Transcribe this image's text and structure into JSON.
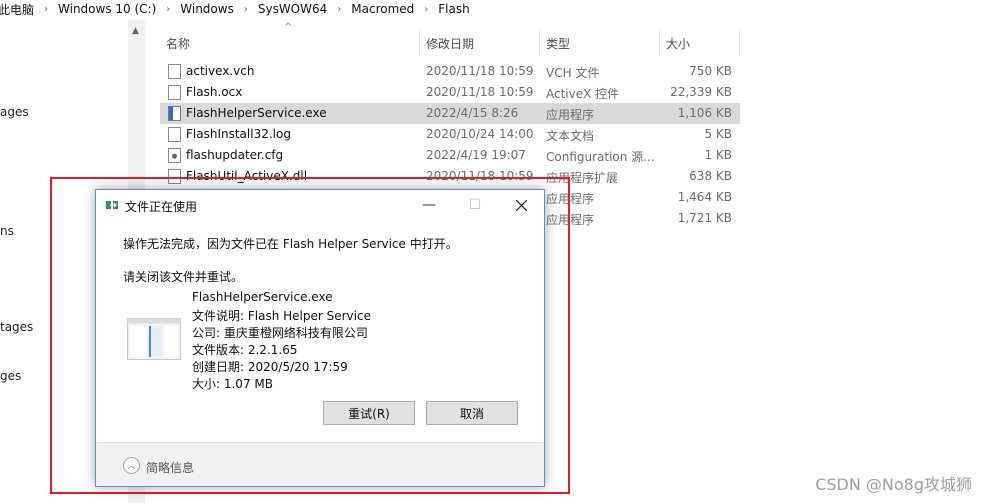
{
  "breadcrumb": [
    "此电脑",
    "Windows 10 (C:)",
    "Windows",
    "SysWOW64",
    "Macromed",
    "Flash"
  ],
  "nav": {
    "items": [
      "ages",
      "ns",
      "tages",
      "ges"
    ]
  },
  "columns": {
    "name": "名称",
    "modified": "修改日期",
    "type": "类型",
    "size": "大小"
  },
  "files": [
    {
      "name": "activex.vch",
      "modified": "2020/11/18 10:59",
      "type": "VCH 文件",
      "size": "750 KB",
      "icon": "file-icon"
    },
    {
      "name": "Flash.ocx",
      "modified": "2020/11/18 10:59",
      "type": "ActiveX 控件",
      "size": "22,339 KB",
      "icon": "file-icon"
    },
    {
      "name": "FlashHelperService.exe",
      "modified": "2022/4/15 8:26",
      "type": "应用程序",
      "size": "1,106 KB",
      "icon": "exe-icon",
      "selected": true
    },
    {
      "name": "FlashInstall32.log",
      "modified": "2020/10/24 14:00",
      "type": "文本文档",
      "size": "5 KB",
      "icon": "text-file-icon"
    },
    {
      "name": "flashupdater.cfg",
      "modified": "2022/4/19 19:07",
      "type": "Configuration 源...",
      "size": "1 KB",
      "icon": "config-file-icon"
    },
    {
      "name": "FlashUtil_ActiveX.dll",
      "modified": "2020/11/18 10:59",
      "type": "应用程序扩展",
      "size": "638 KB",
      "icon": "dll-icon"
    },
    {
      "name": "",
      "modified": "",
      "type": "应用程序",
      "size": "1,464 KB",
      "icon": ""
    },
    {
      "name": "",
      "modified": "",
      "type": "应用程序",
      "size": "1,721 KB",
      "icon": ""
    }
  ],
  "dialog": {
    "title": "文件正在使用",
    "message": "操作无法完成，因为文件已在 Flash Helper Service 中打开。",
    "instruction": "请关闭该文件并重试。",
    "file_name": "FlashHelperService.exe",
    "description": "文件说明: Flash Helper Service",
    "company": "公司: 重庆重橙网络科技有限公司",
    "version": "文件版本: 2.2.1.65",
    "created": "创建日期: 2020/5/20 17:59",
    "size": "大小: 1.07 MB",
    "retry_label": "重试(R)",
    "cancel_label": "取消",
    "details_label": "简略信息"
  },
  "watermark": "CSDN @No8g攻城狮",
  "colors": {
    "highlight_border": "#e02020",
    "selected_row": "#d9d9d9",
    "dialog_border": "#5a8fc8"
  }
}
